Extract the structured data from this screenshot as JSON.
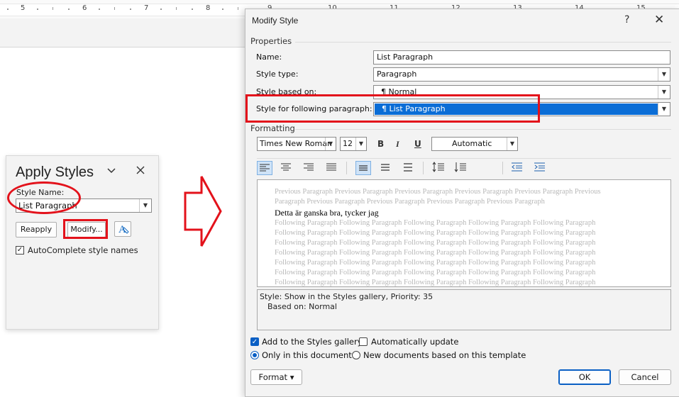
{
  "ruler": {
    "numbers": [
      "5",
      "6",
      "7",
      "8",
      "9",
      "10",
      "11",
      "12",
      "13",
      "14",
      "15"
    ]
  },
  "apply_styles": {
    "title": "Apply Styles",
    "style_name_label": "Style Name:",
    "style_name_value": "List Paragraph",
    "reapply_label": "Reapply",
    "modify_label": "Modify...",
    "font_icon_glyph": "A",
    "autocomplete_label": "AutoComplete style names",
    "autocomplete_checked": true
  },
  "dialog": {
    "title": "Modify Style",
    "help": "?",
    "close": "✕",
    "properties_heading": "Properties",
    "name_label": "Name:",
    "name_value": "List Paragraph",
    "style_type_label": "Style type:",
    "style_type_value": "Paragraph",
    "based_on_label": "Style based on:",
    "based_on_value": "¶  Normal",
    "following_label": "Style for following paragraph:",
    "following_value": "¶  List Paragraph",
    "formatting_heading": "Formatting",
    "font_name": "Times New Roman",
    "font_size": "12",
    "bold": "B",
    "italic": "I",
    "underline": "U",
    "color_value": "Automatic",
    "preview": {
      "previous_1": "Previous Paragraph Previous Paragraph Previous Paragraph Previous Paragraph Previous Paragraph Previous",
      "previous_2": "Paragraph Previous Paragraph Previous Paragraph Previous Paragraph Previous Paragraph",
      "sample": "Detta är ganska bra, tycker jag",
      "following_lines": [
        "Following Paragraph Following Paragraph Following Paragraph Following Paragraph Following Paragraph",
        "Following Paragraph Following Paragraph Following Paragraph Following Paragraph Following Paragraph",
        "Following Paragraph Following Paragraph Following Paragraph Following Paragraph Following Paragraph",
        "Following Paragraph Following Paragraph Following Paragraph Following Paragraph Following Paragraph",
        "Following Paragraph Following Paragraph Following Paragraph Following Paragraph Following Paragraph",
        "Following Paragraph Following Paragraph Following Paragraph Following Paragraph Following Paragraph",
        "Following Paragraph Following Paragraph Following Paragraph Following Paragraph Following Paragraph"
      ]
    },
    "description_line1": "Style: Show in the Styles gallery, Priority: 35",
    "description_line2": "Based on: Normal",
    "add_to_gallery_label": "Add to the Styles gallery",
    "add_to_gallery_checked": true,
    "auto_update_label": "Automatically update",
    "auto_update_checked": false,
    "only_this_doc_label": "Only in this document",
    "new_docs_label": "New documents based on this template",
    "format_button": "Format ▾",
    "ok_button": "OK",
    "cancel_button": "Cancel"
  },
  "colors": {
    "highlight_red": "#e3121b",
    "selection_blue": "#0a6dd6",
    "accent_blue": "#0a5fc4"
  }
}
